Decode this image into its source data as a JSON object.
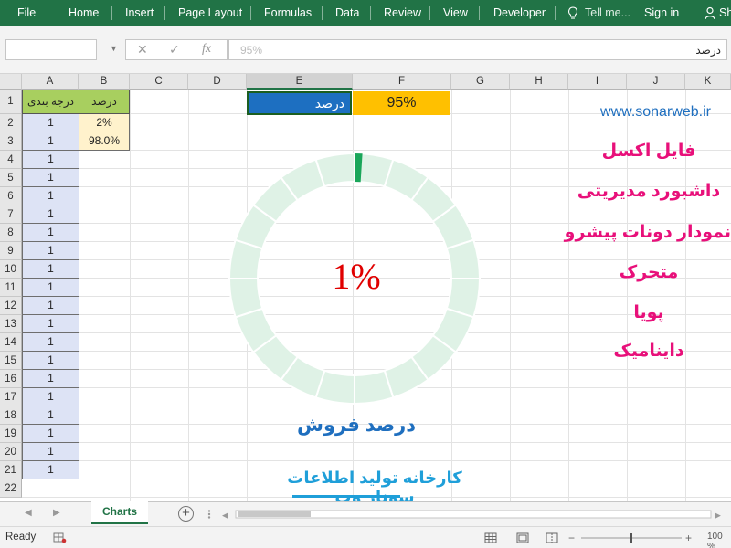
{
  "ribbon": {
    "tabs": [
      "File",
      "Home",
      "Insert",
      "Page Layout",
      "Formulas",
      "Data",
      "Review",
      "View",
      "Developer"
    ],
    "tell_me": "Tell me...",
    "sign_in": "Sign in",
    "share": "Share",
    "background": "#217346"
  },
  "formula_bar": {
    "name_box": "",
    "cancel_icon": "✕",
    "enter_icon": "✓",
    "fx_label": "fx",
    "value": "95%",
    "content_right": "درصد"
  },
  "grid": {
    "columns": [
      "A",
      "B",
      "C",
      "D",
      "E",
      "F",
      "G",
      "H",
      "I",
      "J",
      "K"
    ],
    "rows": [
      "1",
      "2",
      "3",
      "4",
      "5",
      "6",
      "7",
      "8",
      "9",
      "10",
      "11",
      "12",
      "13",
      "14",
      "15",
      "16",
      "17",
      "18",
      "19",
      "20",
      "21",
      "22"
    ],
    "col_a_header": "درجه بندی",
    "col_b_header": "درصد",
    "col_a_values": [
      "1",
      "1",
      "1",
      "1",
      "1",
      "1",
      "1",
      "1",
      "1",
      "1",
      "1",
      "1",
      "1",
      "1",
      "1",
      "1",
      "1",
      "1",
      "1",
      "1"
    ],
    "col_b_values": [
      "2%",
      "98.0%"
    ],
    "e1_label": "درصد",
    "f1_value": "95%"
  },
  "chart_data": {
    "type": "pie",
    "variant": "donut",
    "segments": 20,
    "values": [
      2,
      98
    ],
    "center_label": "1%",
    "title": "درصد فروش",
    "highlight_color": "#1aa65a",
    "segment_color": "#dff2e6"
  },
  "branding": {
    "website": "www.sonarweb.ir",
    "lines": [
      "فایل اکسل",
      "داشبورد مدیریتی",
      "نمودار دونات پیشرو",
      "متحرک",
      "پویا",
      "داینامیک"
    ],
    "footer": "کارخانه تولید اطلاعات سونار وب"
  },
  "sheet_tabs": {
    "active": "Charts",
    "add_icon": "+"
  },
  "status_bar": {
    "ready": "Ready",
    "zoom": "100 %"
  }
}
